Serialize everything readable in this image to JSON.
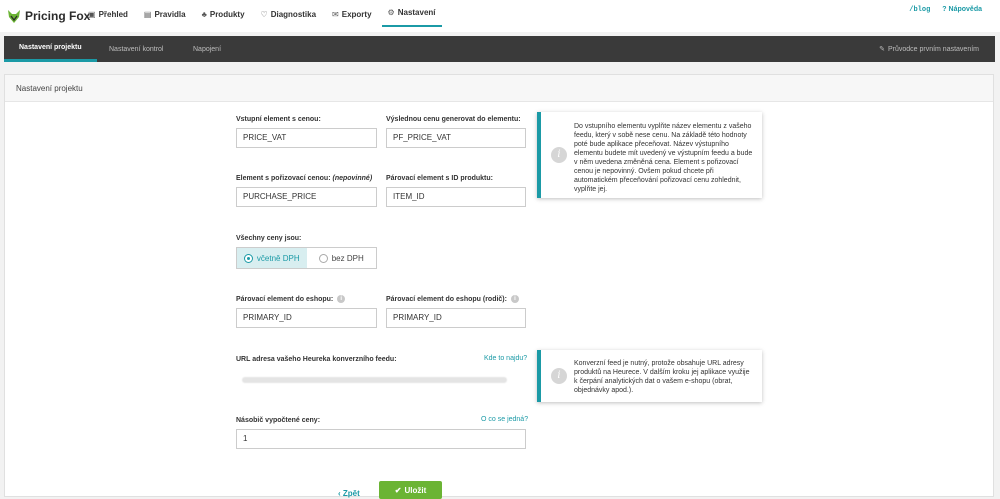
{
  "app": {
    "name": "Pricing Fox"
  },
  "nav": [
    {
      "label": "Přehled",
      "icon": "▣"
    },
    {
      "label": "Pravidla",
      "icon": "▤"
    },
    {
      "label": "Produkty",
      "icon": "♣"
    },
    {
      "label": "Diagnostika",
      "icon": "♡"
    },
    {
      "label": "Exporty",
      "icon": "✉"
    },
    {
      "label": "Nastavení",
      "icon": "⚙"
    }
  ],
  "top_right": {
    "blog": "/blog",
    "help": "Nápověda",
    "help_icon": "?"
  },
  "subnav": {
    "tabs": [
      "Nastavení projektu",
      "Nastavení kontrol",
      "Napojení"
    ],
    "guide": "Průvodce prvním nastavením",
    "guide_icon": "✎"
  },
  "card": {
    "title": "Nastavení projektu"
  },
  "fields": {
    "input_element": {
      "label": "Vstupní element s cenou:",
      "value": "PRICE_VAT"
    },
    "output_element": {
      "label": "Výslednou cenu generovat do elementu:",
      "value": "PF_PRICE_VAT"
    },
    "purchase_element": {
      "label": "Element s pořizovací cenou:",
      "optional": "(nepovinné)",
      "value": "PURCHASE_PRICE"
    },
    "id_element": {
      "label": "Párovací element s ID produktu:",
      "value": "ITEM_ID"
    },
    "prices_are": {
      "label": "Všechny ceny jsou:",
      "options": [
        "včetně DPH",
        "bez DPH"
      ],
      "selected": "včetně DPH"
    },
    "eshop_pair": {
      "label": "Párovací element do eshopu:",
      "value": "PRIMARY_ID"
    },
    "eshop_pair_parent": {
      "label": "Párovací element do eshopu (rodič):",
      "value": "PRIMARY_ID"
    },
    "heureka_url": {
      "label": "URL adresa vašeho Heureka konverzního feedu:",
      "link": "Kde to najdu?"
    },
    "multiplier": {
      "label": "Násobič vypočtené ceny:",
      "link": "O co se jedná?",
      "value": "1"
    }
  },
  "notes": {
    "first": "Do vstupního elementu vyplňte název elementu z vašeho feedu, který v sobě nese cenu. Na základě této hodnoty poté bude aplikace přeceňovat. Název výstupního elementu budete mít uvedený ve výstupním feedu a bude v něm uvedena změněná cena. Element s pořizovací cenou je nepovinný. Ovšem pokud chcete při automatickém přeceňování pořizovací cenu zohlednit, vyplňte jej.",
    "second": "Konverzní feed je nutný, protože obsahuje URL adresy produktů na Heurece. V dalším kroku jej aplikace využije k čerpání analytických dat o vašem e-shopu (obrat, objednávky apod.)."
  },
  "actions": {
    "back": "Zpět",
    "save": "Uložit",
    "back_icon": "‹",
    "save_icon": "✔"
  },
  "colors": {
    "accent": "#1b9aa6",
    "save": "#6bb434",
    "subbar": "#3a3a3a"
  }
}
